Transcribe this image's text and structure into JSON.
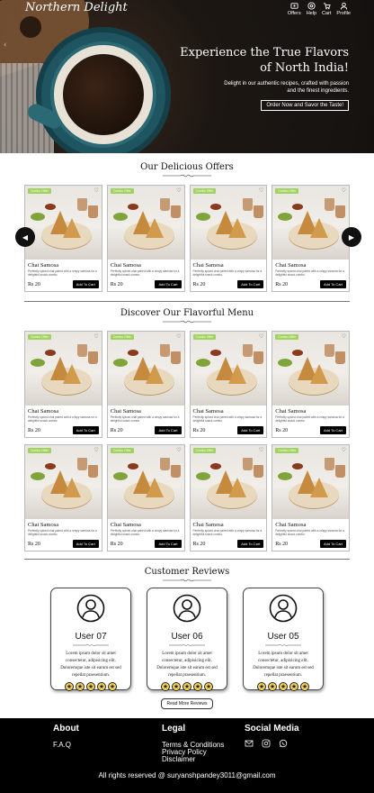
{
  "brand": "Northern Delight",
  "nav": [
    {
      "label": "Offers",
      "icon": "offers-icon"
    },
    {
      "label": "Help",
      "icon": "help-icon"
    },
    {
      "label": "Cart",
      "icon": "cart-icon"
    },
    {
      "label": "Profile",
      "icon": "profile-icon"
    }
  ],
  "hero": {
    "title_line1": "Experience the True Flavors",
    "title_line2": "of North India!",
    "subtitle_line1": "Delight in our authentic recipes, crafted with passion",
    "subtitle_line2": "and the finest ingredients.",
    "cta": "Order Now and Savor the Taste!"
  },
  "offers": {
    "title": "Our Delicious Offers"
  },
  "menu": {
    "title": "Discover Our Flavorful Menu"
  },
  "card": {
    "tag": "Combo Offer",
    "name": "Chai Samosa",
    "desc": "Perfectly spiced chai paired with a crispy samosa for a delightful snack combo.",
    "price": "Rs 20",
    "button": "Add To Cart"
  },
  "reviews": {
    "title": "Customer Reviews",
    "items": [
      {
        "user": "User 07",
        "text": "Lorem ipsum dolor sit amet consectetur, adipisicing elit. Doloremque iste sit earum est sed repellat praesentium.",
        "rating": 5
      },
      {
        "user": "User 06",
        "text": "Lorem ipsum dolor sit amet consectetur, adipisicing elit. Doloremque iste sit earum est sed repellat praesentium.",
        "rating": 5
      },
      {
        "user": "User 05",
        "text": "Lorem ipsum dolor sit amet consectetur, adipisicing elit. Doloremque iste sit earum est sed repellat praesentium.",
        "rating": 5
      }
    ],
    "more": "Read More Reviews"
  },
  "footer": {
    "about_title": "About",
    "about_links": [
      "F.A.Q"
    ],
    "legal_title": "Legal",
    "legal_links": [
      "Terms & Conditions",
      "Privacy Policy",
      "Disclaimer"
    ],
    "social_title": "Social Media",
    "social_icons": [
      "email-icon",
      "instagram-icon",
      "whatsapp-icon"
    ],
    "copyright": "All rights reserved @ suryanshpandey3011@gmail.com"
  }
}
